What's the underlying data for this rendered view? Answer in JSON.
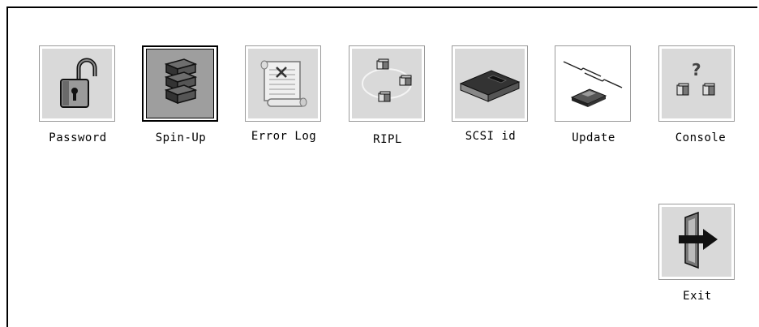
{
  "menu": {
    "items": [
      {
        "label": "Password",
        "icon": "padlock-icon"
      },
      {
        "label": "Spin-Up",
        "icon": "disk-stack-icon",
        "selected": true
      },
      {
        "label": "Error Log",
        "icon": "scroll-log-icon"
      },
      {
        "label": "RIPL",
        "icon": "network-nodes-icon"
      },
      {
        "label": "SCSI id",
        "icon": "drive-box-icon"
      },
      {
        "label": "Update",
        "icon": "diskette-update-icon"
      },
      {
        "label": "Console",
        "icon": "console-question-icon"
      }
    ],
    "exit": {
      "label": "Exit",
      "icon": "exit-door-icon"
    }
  },
  "colors": {
    "background": "#ffffff",
    "icon_bg": "#d9d9d9",
    "selected_bg": "#9e9e9e"
  }
}
